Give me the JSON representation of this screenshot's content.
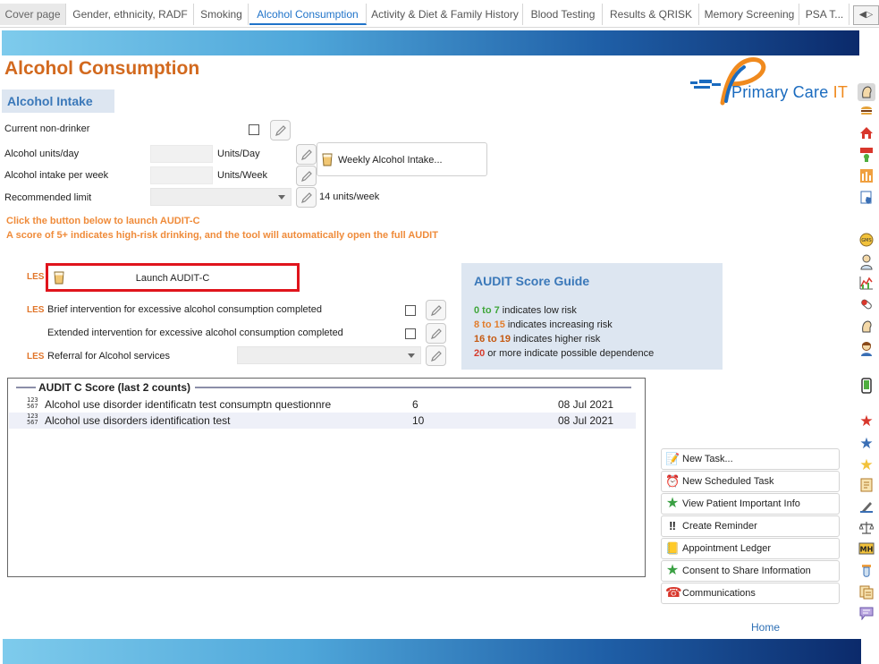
{
  "tabs": [
    "Cover page",
    "Gender, ethnicity, RADF",
    "Smoking",
    "Alcohol Consumption",
    "Activity & Diet & Family History",
    "Blood Testing",
    "Results & QRISK",
    "Memory Screening",
    "PSA T..."
  ],
  "tab_arrows": "◀▷",
  "page_title": "Alcohol Consumption",
  "section_header": "Alcohol Intake",
  "logo": {
    "text_main": "Primary Care ",
    "text_accent": "IT"
  },
  "fields": {
    "current_non_drinker": "Current non-drinker",
    "units_day": "Alcohol units/day",
    "units_day_unit": "Units/Day",
    "intake_week": "Alcohol intake per week",
    "intake_week_unit": "Units/Week",
    "recommended_limit": "Recommended limit",
    "recommended_limit_value": "14 units/week",
    "weekly_button": "Weekly Alcohol Intake..."
  },
  "notes": {
    "line1": "Click the button below to launch AUDIT-C",
    "line2": "A score of 5+ indicates high-risk drinking, and the tool will automatically open the full AUDIT"
  },
  "les_label": "LES",
  "audit_button": "Launch AUDIT-C",
  "interventions": {
    "brief": "Brief intervention for excessive alcohol consumption completed",
    "extended": "Extended intervention for excessive alcohol consumption completed",
    "referral": "Referral for Alcohol services"
  },
  "guide": {
    "title": "AUDIT Score Guide",
    "rows": [
      {
        "range": "0 to 7",
        "text": " indicates low risk"
      },
      {
        "range": "8 to 15",
        "text": " indicates increasing risk"
      },
      {
        "range": "16 to 19",
        "text": " indicates higher risk"
      },
      {
        "range": "20",
        "text": " or more indicate possible dependence"
      }
    ]
  },
  "score_panel": {
    "title": "AUDIT C Score (last 2 counts)",
    "rows": [
      {
        "name": "Alcohol use disorder identificatn test consumptn questionnre",
        "value": "6",
        "date": "08 Jul 2021"
      },
      {
        "name": "Alcohol use disorders identification test",
        "value": "10",
        "date": "08 Jul 2021"
      }
    ]
  },
  "actions": [
    {
      "label": "New Task...",
      "icon": "task-icon",
      "glyph": "📝"
    },
    {
      "label": "New Scheduled Task",
      "icon": "scheduled-task-icon",
      "glyph": "⏰"
    },
    {
      "label": "View Patient Important Info",
      "icon": "green-star-icon",
      "glyph": "★"
    },
    {
      "label": "Create Reminder",
      "icon": "exclamation-icon",
      "glyph": "‼"
    },
    {
      "label": "Appointment Ledger",
      "icon": "ledger-icon",
      "glyph": "📒"
    },
    {
      "label": "Consent to Share Information",
      "icon": "green-star-icon",
      "glyph": "★"
    },
    {
      "label": "Communications",
      "icon": "phone-icon",
      "glyph": "☎"
    }
  ],
  "home_link": "Home",
  "colors": {
    "title": "#d2691e",
    "accent_blue": "#3a78b9",
    "highlight_red": "#e0141c"
  }
}
